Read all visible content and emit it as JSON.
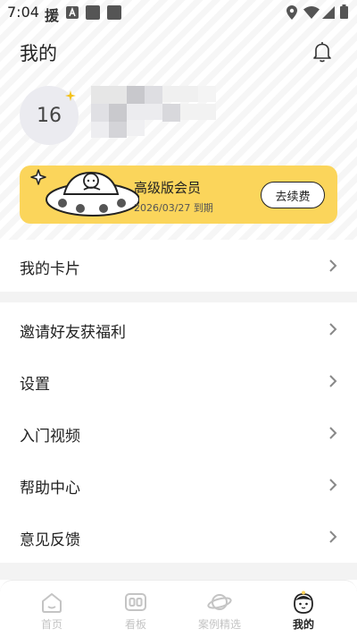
{
  "status_bar": {
    "time": "7:04",
    "app_glyph": "援",
    "icons": [
      "app-notification-icon",
      "a-badge-icon",
      "square-icon",
      "square-icon",
      "location-icon",
      "wifi-icon",
      "signal-icon",
      "battery-icon"
    ]
  },
  "header": {
    "title": "我的",
    "bell_icon": "bell-icon"
  },
  "profile": {
    "avatar_text": "16",
    "badge_icon": "star-icon",
    "name_blurred": true
  },
  "vip": {
    "title": "高级版会员",
    "expiry": "2026/03/27 到期",
    "renew_label": "去续费",
    "background": "#fbd55b"
  },
  "menu": [
    {
      "label": "我的卡片"
    },
    {
      "label": "邀请好友获福利"
    },
    {
      "label": "设置"
    },
    {
      "label": "入门视频"
    },
    {
      "label": "帮助中心"
    },
    {
      "label": "意见反馈"
    }
  ],
  "tabs": [
    {
      "label": "首页",
      "icon": "home-icon",
      "active": false
    },
    {
      "label": "看板",
      "icon": "board-icon",
      "active": false
    },
    {
      "label": "案例精选",
      "icon": "planet-icon",
      "active": false
    },
    {
      "label": "我的",
      "icon": "mascot-icon",
      "active": true
    }
  ],
  "colors": {
    "accent": "#fbd55b",
    "text": "#222222",
    "inactive_tab": "#c4c4c4",
    "separator": "#f3f3f3"
  }
}
